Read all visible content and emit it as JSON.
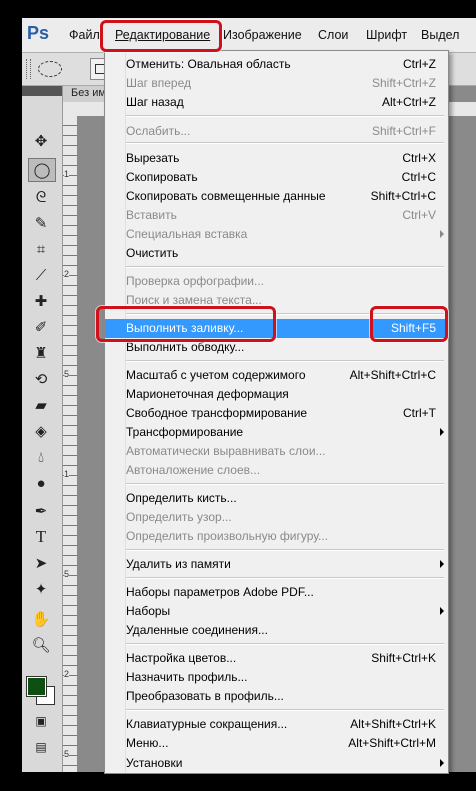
{
  "app": {
    "logo": "Ps",
    "menubar": [
      "Файл",
      "Редактирование",
      "Изображение",
      "Слои",
      "Шрифт",
      "Выдел"
    ],
    "doc_tab": "Без им",
    "ruler_numbers": [
      "1",
      "2",
      "5",
      "1",
      "5",
      "2",
      "5"
    ],
    "fg_color": "#0e4f12",
    "bg_color": "#ffffff"
  },
  "menu": {
    "items": [
      {
        "label": "Отменить: Овальная область",
        "shortcut": "Ctrl+Z",
        "enabled": true
      },
      {
        "label": "Шаг вперед",
        "shortcut": "Shift+Ctrl+Z",
        "enabled": false
      },
      {
        "label": "Шаг назад",
        "shortcut": "Alt+Ctrl+Z",
        "enabled": true
      },
      {
        "label": "Ослабить...",
        "shortcut": "Shift+Ctrl+F",
        "enabled": false
      },
      {
        "label": "Вырезать",
        "shortcut": "Ctrl+X",
        "enabled": true
      },
      {
        "label": "Скопировать",
        "shortcut": "Ctrl+C",
        "enabled": true
      },
      {
        "label": "Скопировать совмещенные данные",
        "shortcut": "Shift+Ctrl+C",
        "enabled": true
      },
      {
        "label": "Вставить",
        "shortcut": "Ctrl+V",
        "enabled": false
      },
      {
        "label": "Специальная вставка",
        "shortcut": "",
        "enabled": false
      },
      {
        "label": "Очистить",
        "shortcut": "",
        "enabled": true
      },
      {
        "label": "Проверка орфографии...",
        "shortcut": "",
        "enabled": false
      },
      {
        "label": "Поиск и замена текста...",
        "shortcut": "",
        "enabled": false
      },
      {
        "label": "Выполнить заливку...",
        "shortcut": "Shift+F5",
        "enabled": true
      },
      {
        "label": "Выполнить обводку...",
        "shortcut": "",
        "enabled": true
      },
      {
        "label": "Масштаб с учетом содержимого",
        "shortcut": "Alt+Shift+Ctrl+C",
        "enabled": true
      },
      {
        "label": "Марионеточная деформация",
        "shortcut": "",
        "enabled": true
      },
      {
        "label": "Свободное трансформирование",
        "shortcut": "Ctrl+T",
        "enabled": true
      },
      {
        "label": "Трансформирование",
        "shortcut": "",
        "enabled": true
      },
      {
        "label": "Автоматически выравнивать слои...",
        "shortcut": "",
        "enabled": false
      },
      {
        "label": "Автоналожение слоев...",
        "shortcut": "",
        "enabled": false
      },
      {
        "label": "Определить кисть...",
        "shortcut": "",
        "enabled": true
      },
      {
        "label": "Определить узор...",
        "shortcut": "",
        "enabled": false
      },
      {
        "label": "Определить произвольную фигуру...",
        "shortcut": "",
        "enabled": false
      },
      {
        "label": "Удалить из памяти",
        "shortcut": "",
        "enabled": true
      },
      {
        "label": "Наборы параметров Adobe PDF...",
        "shortcut": "",
        "enabled": true
      },
      {
        "label": "Наборы",
        "shortcut": "",
        "enabled": true
      },
      {
        "label": "Удаленные соединения...",
        "shortcut": "",
        "enabled": true
      },
      {
        "label": "Настройка цветов...",
        "shortcut": "Shift+Ctrl+K",
        "enabled": true
      },
      {
        "label": "Назначить профиль...",
        "shortcut": "",
        "enabled": true
      },
      {
        "label": "Преобразовать в профиль...",
        "shortcut": "",
        "enabled": true
      },
      {
        "label": "Клавиатурные сокращения...",
        "shortcut": "Alt+Shift+Ctrl+K",
        "enabled": true
      },
      {
        "label": "Меню...",
        "shortcut": "Alt+Shift+Ctrl+M",
        "enabled": true
      },
      {
        "label": "Установки",
        "shortcut": "",
        "enabled": true
      }
    ]
  }
}
